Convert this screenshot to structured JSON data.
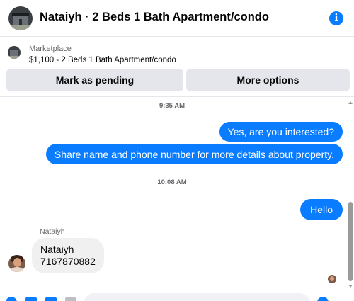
{
  "header": {
    "title": "Nataiyh · 2 Beds 1 Bath Apartment/condo",
    "info_icon": "i"
  },
  "marketplace": {
    "label": "Marketplace",
    "listing": "$1,100 - 2 Beds 1 Bath Apartment/condo"
  },
  "actions": {
    "pending_label": "Mark as pending",
    "more_label": "More options"
  },
  "messages": {
    "time_1": "9:35 AM",
    "out_1": "Yes, are you interested?",
    "out_2": "Share name and phone number for more details about property.",
    "time_2": "10:08 AM",
    "out_3": "Hello",
    "sender": "Nataiyh",
    "in_line_1": "Nataiyh",
    "in_line_2": "7167870882"
  },
  "colors": {
    "accent": "#0a7cff",
    "bubble_in": "#f0f0f0",
    "button_bg": "#e4e6eb"
  },
  "icons": [
    "info-icon",
    "listing-thumbnail",
    "avatar",
    "seen-avatar"
  ]
}
